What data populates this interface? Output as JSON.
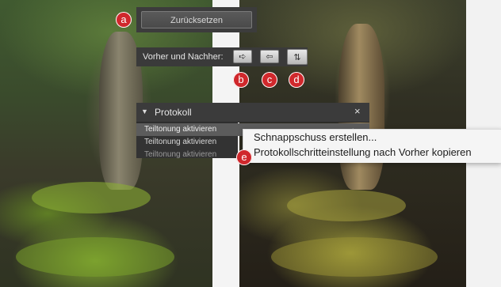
{
  "reset": {
    "label": "Zurücksetzen"
  },
  "before_after": {
    "label": "Vorher und Nachher:",
    "buttons": [
      {
        "icon": "copy-right-arrow-icon",
        "glyph": "➪"
      },
      {
        "icon": "copy-left-arrow-icon",
        "glyph": "⇦"
      },
      {
        "icon": "swap-vertical-icon",
        "glyph": "⇅"
      }
    ]
  },
  "badges": [
    "a",
    "b",
    "c",
    "d",
    "e"
  ],
  "history": {
    "title": "Protokoll",
    "close_glyph": "×",
    "toggle_glyph": "▼",
    "items": [
      "Teiltonung aktivieren",
      "Teiltonung aktivieren",
      "Teiltonung aktivieren"
    ]
  },
  "context_menu": {
    "items": [
      "Schnappschuss erstellen...",
      "Protokollschritteinstellung nach Vorher kopieren"
    ]
  },
  "colors": {
    "badge": "#d0282c",
    "panel": "#3b3b3b",
    "menu": "#f5f5f5"
  }
}
